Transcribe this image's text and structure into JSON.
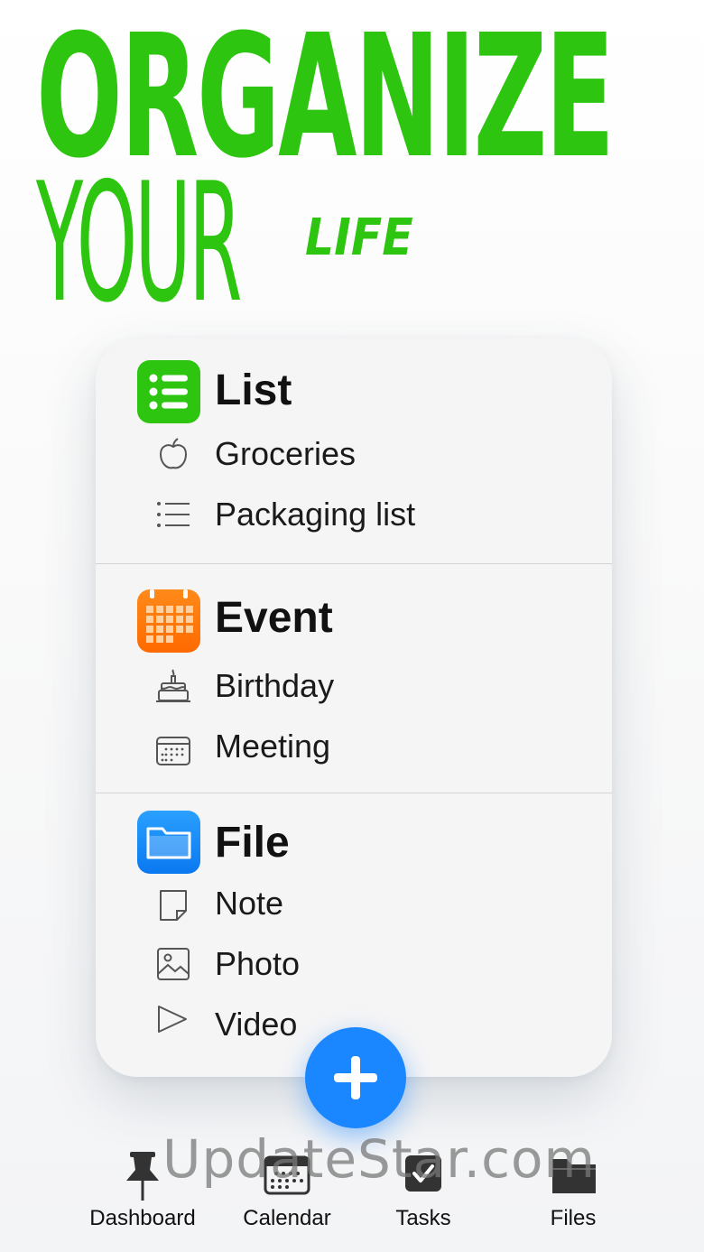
{
  "headline": {
    "line1": "ORGANIZE",
    "line2": "YOUR",
    "line3": "LIFE"
  },
  "accent_color": "#2dc510",
  "categories": [
    {
      "title": "List",
      "icon": "list-icon",
      "color": "#2dc510",
      "items": [
        {
          "label": "Groceries",
          "icon": "apple-icon"
        },
        {
          "label": "Packaging list",
          "icon": "bullet-list-icon"
        }
      ]
    },
    {
      "title": "Event",
      "icon": "calendar-icon",
      "color": "#ff7a00",
      "items": [
        {
          "label": "Birthday",
          "icon": "birthday-cake-icon"
        },
        {
          "label": "Meeting",
          "icon": "calendar-small-icon"
        }
      ]
    },
    {
      "title": "File",
      "icon": "folder-icon",
      "color": "#1a86ff",
      "items": [
        {
          "label": "Note",
          "icon": "note-icon"
        },
        {
          "label": "Photo",
          "icon": "photo-icon"
        },
        {
          "label": "Video",
          "icon": "play-icon"
        }
      ]
    }
  ],
  "fab": {
    "icon": "plus-icon",
    "color": "#1a86ff"
  },
  "tabbar": [
    {
      "label": "Dashboard",
      "icon": "pin-icon"
    },
    {
      "label": "Calendar",
      "icon": "calendar-tab-icon"
    },
    {
      "label": "Tasks",
      "icon": "checkbox-icon"
    },
    {
      "label": "Files",
      "icon": "folder-tab-icon"
    }
  ],
  "watermark": "UpdateStar.com"
}
